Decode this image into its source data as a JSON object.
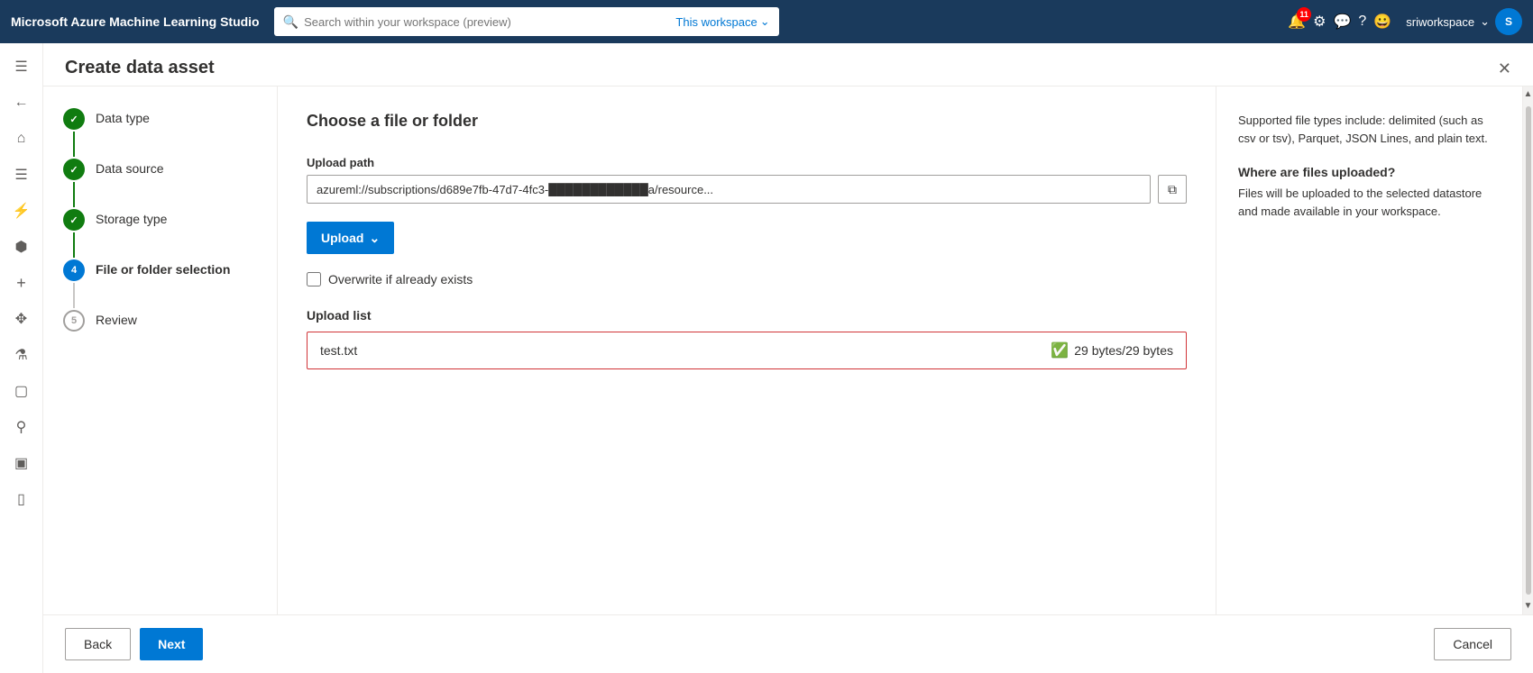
{
  "topbar": {
    "brand": "Microsoft Azure Machine Learning Studio",
    "search_placeholder": "Search within your workspace (preview)",
    "workspace_label": "This workspace",
    "notification_badge": "11",
    "user_name": "sriworkspace"
  },
  "panel": {
    "title": "Create data asset",
    "close_label": "×"
  },
  "steps": [
    {
      "id": 1,
      "label": "Data type",
      "state": "completed"
    },
    {
      "id": 2,
      "label": "Data source",
      "state": "completed"
    },
    {
      "id": 3,
      "label": "Storage type",
      "state": "completed"
    },
    {
      "id": 4,
      "label": "File or folder selection",
      "state": "active"
    },
    {
      "id": 5,
      "label": "Review",
      "state": "pending"
    }
  ],
  "content": {
    "section_title": "Choose a file or folder",
    "upload_path_label": "Upload path",
    "upload_path_value": "azureml://subscriptions/d689e7fb-47d7-4fc3-████████████a/resource...",
    "upload_btn_label": "Upload",
    "overwrite_label": "Overwrite if already exists",
    "upload_list_label": "Upload list",
    "upload_file_name": "test.txt",
    "upload_file_status": "29 bytes/29 bytes"
  },
  "info_sidebar": {
    "supported_types": "Supported file types include: delimited (such as csv or tsv), Parquet, JSON Lines, and plain text.",
    "where_uploaded_title": "Where are files uploaded?",
    "where_uploaded_text": "Files will be uploaded to the selected datastore and made available in your workspace."
  },
  "footer": {
    "back_label": "Back",
    "next_label": "Next",
    "cancel_label": "Cancel"
  },
  "sidebar_icons": [
    {
      "name": "hamburger-icon",
      "symbol": "≡"
    },
    {
      "name": "back-icon",
      "symbol": "←"
    },
    {
      "name": "home-icon",
      "symbol": "⌂"
    },
    {
      "name": "list-icon",
      "symbol": "☰"
    },
    {
      "name": "lightning-icon",
      "symbol": "⚡"
    },
    {
      "name": "network-icon",
      "symbol": "⬡"
    },
    {
      "name": "plus-icon",
      "symbol": "+"
    },
    {
      "name": "table-icon",
      "symbol": "⊞"
    },
    {
      "name": "flask-icon",
      "symbol": "⚗"
    },
    {
      "name": "grid-icon",
      "symbol": "▦"
    },
    {
      "name": "branch-icon",
      "symbol": "⑂"
    },
    {
      "name": "database-icon",
      "symbol": "▤"
    },
    {
      "name": "cube-icon",
      "symbol": "⬡"
    }
  ]
}
